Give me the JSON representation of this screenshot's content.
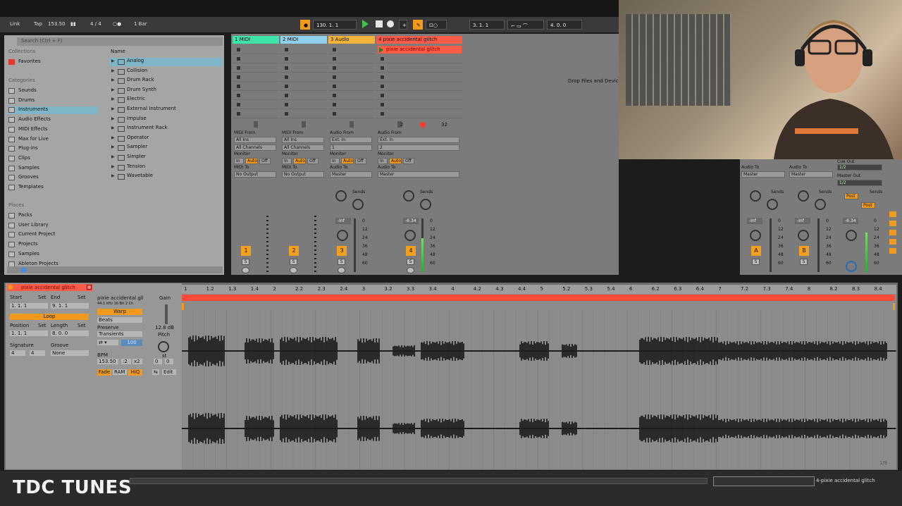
{
  "control_bar": {
    "link": "Link",
    "tap": "Tap",
    "tempo": "153.50",
    "signature": "4 / 4",
    "quantize": "1 Bar",
    "position": "130.  1.  1",
    "position2": "3.  1.  1",
    "loop_length": "4.  0.  0"
  },
  "browser": {
    "search_placeholder": "Search (Ctrl + F)",
    "collections_head": "Collections",
    "favorites": "Favorites",
    "categories_head": "Categories",
    "categories": [
      "Sounds",
      "Drums",
      "Instruments",
      "Audio Effects",
      "MIDI Effects",
      "Max for Live",
      "Plug-ins",
      "Clips",
      "Samples",
      "Grooves",
      "Templates"
    ],
    "places_head": "Places",
    "places": [
      "Packs",
      "User Library",
      "Current Project",
      "Projects",
      "Samples",
      "Ableton Projects"
    ],
    "name_head": "Name",
    "devices": [
      "Analog",
      "Collision",
      "Drum Rack",
      "Drum Synth",
      "Electric",
      "External Instrument",
      "Impulse",
      "Instrument Rack",
      "Operator",
      "Sampler",
      "Simpler",
      "Tension",
      "Wavetable"
    ]
  },
  "tracks": [
    {
      "name": "1 MIDI",
      "color": "#3ee3a8",
      "num": "1"
    },
    {
      "name": "2 MIDI",
      "color": "#8fd0ee",
      "num": "2"
    },
    {
      "name": "3 Audio",
      "color": "#f5b33b",
      "num": "3"
    },
    {
      "name": "4 pixie accidental glitch",
      "color": "#ff5c48",
      "num": "4"
    }
  ],
  "session": {
    "clip_name": "pixie accidental glitch",
    "midi_from": "MIDI From",
    "audio_from": "Audio From",
    "all_ins": "All Ins",
    "ext_in": "Ext. In",
    "all_channels": "All Channels",
    "monitor": "Monitor",
    "monitor_in": "In",
    "monitor_auto": "Auto",
    "monitor_off": "Off",
    "midi_to": "MIDI To",
    "audio_to": "Audio To",
    "no_output": "No Output",
    "master": "Master",
    "sends": "Sends",
    "inf": "-Inf",
    "vol4": "-6.34",
    "scale": [
      "0",
      "12",
      "24",
      "36",
      "48",
      "60"
    ],
    "in_ch1": "1",
    "in_ch2": "2",
    "slot_count_a": "2",
    "slot_count_b": "32",
    "drop_text": "Drop Files and Devices Here",
    "solo": "S",
    "return_a": "A",
    "return_b": "B",
    "cue_out": "Cue Out",
    "master_out": "Master Out",
    "cue_val": "1/2",
    "master_val": "1/2",
    "post": "Post",
    "master_vol": "-6.34"
  },
  "detail": {
    "clip_title": "pixie accidental glitch",
    "start": "Start",
    "end": "End",
    "set": "Set",
    "start_val": "1.  1.  1",
    "end_val": "9.  1.  1",
    "loop": "Loop",
    "position": "Position",
    "length": "Length",
    "position_val": "1.  1.  1",
    "length_val": "8.  0.  0",
    "signature": "Signature",
    "groove": "Groove",
    "sig_num": "4",
    "sig_den": "4",
    "groove_val": "None",
    "sample_name": "pixie accidental gli",
    "sample_info": "44.1 kHz  16 Bit  2 Ch",
    "gain": "Gain",
    "warp": "Warp",
    "beats": "Beats",
    "preserve": "Preserve",
    "transients": "Transients",
    "gain_db": "12.8 dB",
    "pitch": "Pitch",
    "st": "st",
    "bpm_label": "BPM",
    "bpm_val": "153.50",
    "half": ":2",
    "double": "x2",
    "pitch_vals": [
      "0",
      "0"
    ],
    "amount": "100",
    "fade": "Fade",
    "ram": "RAM",
    "hiq": "HiQ",
    "edit": "Edit",
    "page": "1/8",
    "ruler": [
      "1",
      "1.2",
      "1.3",
      "1.4",
      "2",
      "2.2",
      "2.3",
      "2.4",
      "3",
      "3.2",
      "3.3",
      "3.4",
      "4",
      "4.2",
      "4.3",
      "4.4",
      "5",
      "5.2",
      "5.3",
      "5.4",
      "6",
      "6.2",
      "6.3",
      "6.4",
      "7",
      "7.2",
      "7.3",
      "7.4",
      "8",
      "8.2",
      "8.3",
      "8.4"
    ]
  },
  "bottom": {
    "watermark": "TDC TUNES",
    "selected_track": "4-pixie accidental glitch"
  },
  "colors": {
    "accent_orange": "#f39a1e",
    "play_green": "#3ec44a",
    "clip_red": "#ff4a3a"
  }
}
